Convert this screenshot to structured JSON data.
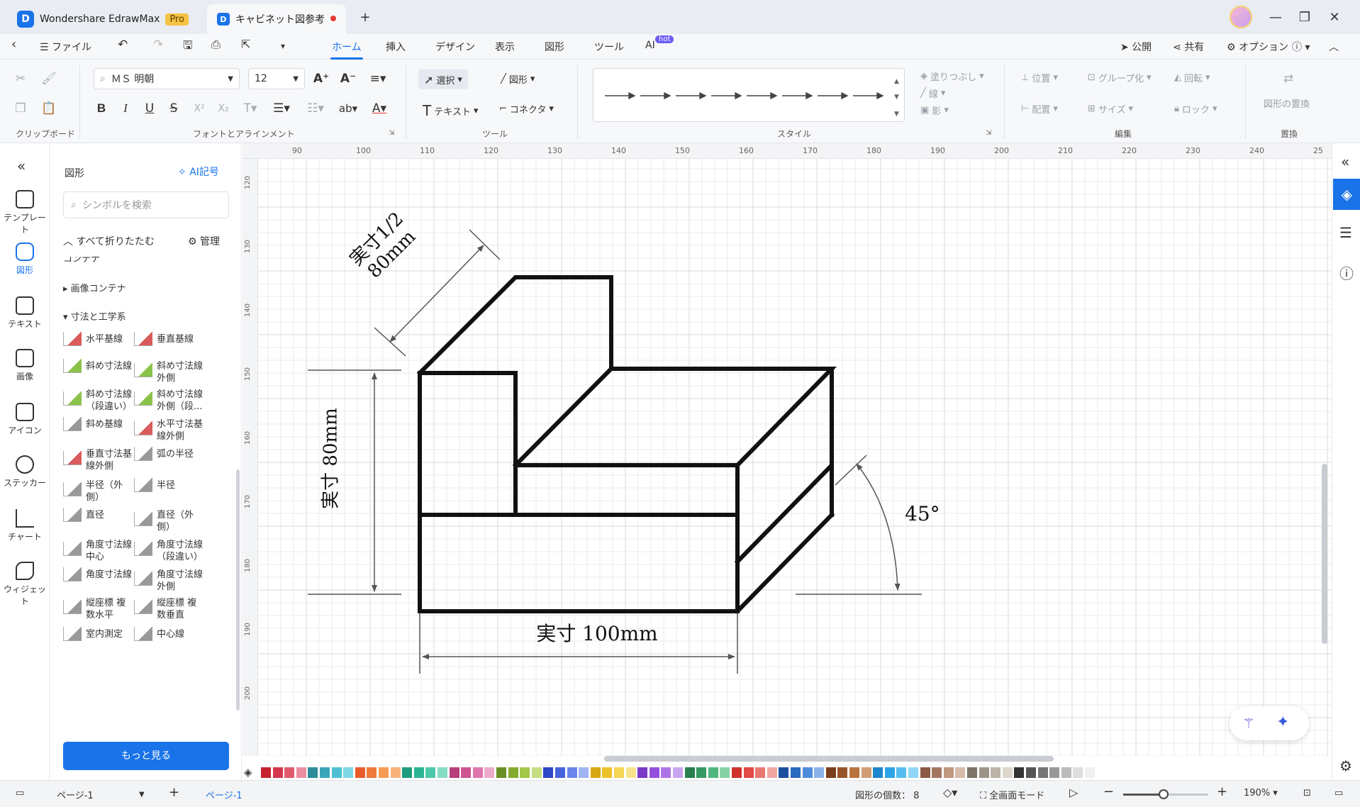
{
  "app": {
    "name": "Wondershare EdrawMax",
    "badge": "Pro",
    "document_tab": "キャビネット図参考"
  },
  "menu": {
    "file": "ファイル",
    "tabs": [
      "ホーム",
      "挿入",
      "デザイン",
      "表示",
      "図形",
      "ツール",
      "AI"
    ],
    "active_tab": "ホーム",
    "ai_badge": "hot",
    "publish": "公開",
    "share": "共有",
    "options": "オプション"
  },
  "ribbon": {
    "font_name": "ＭＳ 明朝",
    "font_size": "12",
    "select": "選択",
    "shape": "図形",
    "text": "テキスト",
    "connector": "コネクタ",
    "fill": "塗りつぶし",
    "line": "線",
    "shadow": "影",
    "position": "位置",
    "group": "グループ化",
    "rotate": "回転",
    "align": "配置",
    "size": "サイズ",
    "lock": "ロック",
    "replace_shape": "図形の置換",
    "groups": {
      "clipboard": "クリップボード",
      "font": "フォントとアラインメント",
      "tools": "ツール",
      "style": "スタイル",
      "edit": "編集",
      "replace": "置換"
    },
    "text_glyphs": {
      "bold": "B",
      "italic": "I",
      "underline": "U",
      "strike": "S",
      "superscript": "X²",
      "subscript": "X₂",
      "ab": "ab"
    }
  },
  "rail": {
    "items": [
      "テンプレート",
      "図形",
      "テキスト",
      "画像",
      "アイコン",
      "ステッカー",
      "チャート",
      "ウィジェット"
    ],
    "active": "図形"
  },
  "panel": {
    "title": "図形",
    "ai_symbol": "AI記号",
    "search_placeholder": "シンボルを検索",
    "collapse_all": "すべて折りたたむ",
    "manage": "管理",
    "partial_category": "コンテナ",
    "category_image_container": "画像コンテナ",
    "category_dimension": "寸法と工学系",
    "symbols": [
      [
        "水平基線"
      ],
      [
        "垂直基線"
      ],
      [
        "斜め寸法線"
      ],
      [
        "斜め寸法線",
        "外側"
      ],
      [
        "斜め寸法線",
        "（段違い）"
      ],
      [
        "斜め寸法線",
        "外側（段..."
      ],
      [
        "斜め基線"
      ],
      [
        "水平寸法基",
        "線外側"
      ],
      [
        "垂直寸法基",
        "線外側"
      ],
      [
        "弧の半径"
      ],
      [
        "半径（外",
        "側）"
      ],
      [
        "半径"
      ],
      [
        "直径"
      ],
      [
        "直径（外",
        "側）"
      ],
      [
        "角度寸法線",
        "中心"
      ],
      [
        "角度寸法線",
        "（段違い）"
      ],
      [
        "角度寸法線"
      ],
      [
        "角度寸法線",
        "外側"
      ],
      [
        "縦座標 複",
        "数水平"
      ],
      [
        "縦座標 複",
        "数垂直"
      ],
      [
        "室内測定"
      ],
      [
        "中心線"
      ]
    ],
    "more_button": "もっと見る"
  },
  "ruler": {
    "top": [
      "90",
      "100",
      "110",
      "120",
      "130",
      "140",
      "150",
      "160",
      "170",
      "180",
      "190",
      "200",
      "210",
      "220",
      "230",
      "240",
      "25"
    ],
    "left": [
      "120",
      "130",
      "140",
      "150",
      "160",
      "170",
      "180",
      "190",
      "200"
    ]
  },
  "drawing": {
    "label_top_line1": "実寸1/2",
    "label_top_line2": "80mm",
    "label_left": "実寸 80mm",
    "label_bottom": "実寸 100mm",
    "label_angle": "45°"
  },
  "palette": [
    "#c7222f",
    "#d3374a",
    "#e05a6c",
    "#eb8da0",
    "#2e8c9a",
    "#39a6b8",
    "#4fc0d3",
    "#7fd7e6",
    "#e85c2c",
    "#f07a3a",
    "#f59b55",
    "#f7b27c",
    "#1f9c7e",
    "#2cb594",
    "#4ec9aa",
    "#85dcc4",
    "#b8407a",
    "#cd5592",
    "#dd77ab",
    "#ecaacb",
    "#6b8f27",
    "#84aa2e",
    "#a4c649",
    "#c6dd82",
    "#2f48c7",
    "#4564dc",
    "#6a86ea",
    "#a0b3f2",
    "#d8a714",
    "#eec22a",
    "#f5d552",
    "#f8e38d",
    "#7a38c4",
    "#9550db",
    "#ae75e6",
    "#c9a4ef",
    "#2a7f4f",
    "#349a61",
    "#4fb67d",
    "#87d1a6",
    "#d0312d",
    "#e14b46",
    "#eb7772",
    "#f2a7a3",
    "#1b4f9e",
    "#2a69c0",
    "#4f8ddb",
    "#8ab3ea",
    "#7a3e1d",
    "#985429",
    "#b8733f",
    "#d09d75",
    "#1e86cc",
    "#2ea3e6",
    "#55bdf0",
    "#92d6f6",
    "#8a5a44",
    "#a47560",
    "#c0977f",
    "#d8bba8",
    "#7d7567",
    "#9c9486",
    "#bcb5a8",
    "#dcd6cb",
    "#333333",
    "#555555",
    "#777777",
    "#999999",
    "#bbbbbb",
    "#dddddd",
    "#f0f0f0"
  ],
  "status": {
    "page_dropdown": "ページ-1",
    "page_tab": "ページ-1",
    "shape_count": "図形の個数：",
    "shape_count_value": "8",
    "fullscreen": "全画面モード",
    "zoom": "190%"
  },
  "colors": {
    "accent": "#1a73e8",
    "titlebar": "#e9ecf2",
    "ribbon": "#f7f8fa",
    "grid_minor": "#ebebeb",
    "grid_major": "#d9d9d9"
  },
  "icons": [
    "back-icon",
    "menu-icon",
    "undo-icon",
    "redo-icon",
    "save-icon",
    "print-icon",
    "export-icon",
    "more-icon",
    "publish-icon",
    "share-icon",
    "gear-icon",
    "help-icon",
    "cut-icon",
    "format-painter-icon",
    "copy-icon",
    "paste-icon",
    "pointer-icon",
    "pen-icon",
    "text-tool-icon",
    "connector-icon",
    "search-icon",
    "sparkle-icon",
    "collapse-icon",
    "close-icon",
    "minimize-icon",
    "maximize-icon",
    "avatar"
  ]
}
